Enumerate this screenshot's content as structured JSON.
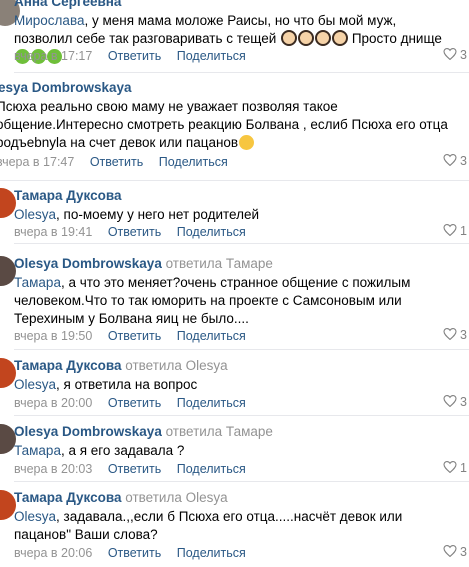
{
  "comments": [
    {
      "author": "Анна Сергеевна",
      "mention": "Мирослава",
      "text": ", у меня мама моложе Раисы, но что бы мой муж, позволил себе так разговаривать с тещей",
      "text_end": "Просто днище",
      "time": "вчера в 17:17",
      "reply": "Ответить",
      "share": "Поделиться",
      "likes": "3"
    },
    {
      "author": "esya Dombrowskaya",
      "text": "Псюха реально свою маму не уважает позволяя такое общение.Интересно смотреть реакцию Болвана , еслиб Псюха его отца pодъebnyla на счет девок или пацанов",
      "time": "вчера в 17:47",
      "reply": "Ответить",
      "share": "Поделиться",
      "likes": "3"
    },
    {
      "author": "Тамара Дуксова",
      "mention": "Olesya",
      "text": ", по-моему у него нет родителей",
      "time": "вчера в 19:41",
      "reply": "Ответить",
      "share": "Поделиться",
      "likes": "1"
    },
    {
      "author": "Olesya Dombrowskaya",
      "reply_to": "ответила Тамаре",
      "mention": "Тамара",
      "text": ", а что это меняет?очень странное общение с пожилым человеком.Что то так юморить на проекте с Самсоновым или Терехиным у Болвана яиц не было....",
      "time": "вчера в 19:50",
      "reply": "Ответить",
      "share": "Поделиться",
      "likes": "3"
    },
    {
      "author": "Тамара Дуксова",
      "reply_to": "ответила Olesya",
      "mention": "Olesya",
      "text": ", я ответила на вопрос",
      "time": "вчера в 20:00",
      "reply": "Ответить",
      "share": "Поделиться",
      "likes": "3"
    },
    {
      "author": "Olesya Dombrowskaya",
      "reply_to": "ответила Тамаре",
      "mention": "Тамара",
      "text": ", а я его задавала ?",
      "time": "вчера в 20:03",
      "reply": "Ответить",
      "share": "Поделиться",
      "likes": "1"
    },
    {
      "author": "Тамара Дуксова",
      "reply_to": "ответила Olesya",
      "mention": "Olesya",
      "text": ", задавала.,,если б Псюха его отца.....насчёт девок или пацанов\" Ваши слова?",
      "time": "вчера в 20:06",
      "reply": "Ответить",
      "share": "Поделиться",
      "likes": "3"
    }
  ],
  "colors": {
    "link": "#2a5885",
    "muted": "#939393",
    "divider": "#e7e8ec"
  }
}
